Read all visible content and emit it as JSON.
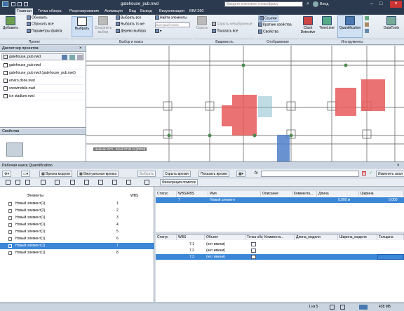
{
  "titlebar": {
    "file": "gatehouse_pub.nwd",
    "search_placeholder": "Введите ключевое слово/фразу",
    "user": "Вход"
  },
  "tabs": [
    "Главная",
    "Точка обзора",
    "Рецензирование",
    "Анимация",
    "Вид",
    "Вывод",
    "Визуализация",
    "BIM 360"
  ],
  "ribbon": {
    "add": "Добавить",
    "refresh": "Обновить",
    "reset_all": "Сбросить все",
    "file_params": "Параметры файла",
    "select": "Выбрать",
    "save_selection": "Сохранить выбор",
    "select_all": "Выбрать все",
    "select_same": "Выбрать то же",
    "selection_tree": "Дерево выбора",
    "find_items": "Найти элементы",
    "quick_find_placeholder": "Быстрый поиск",
    "hide": "Скрыть",
    "hide_unselected": "Скрыть невыбранные",
    "show_all": "Показать все",
    "links": "Ссылки",
    "quick_props": "Краткие свойства",
    "properties": "Свойства",
    "clash": "Clash Detective",
    "timeliner": "TimeLiner",
    "quantification": "Quantification",
    "datatools": "DataTools",
    "groups": {
      "project": "Проект",
      "select_search": "Выбор и поиск",
      "visibility": "Видимость",
      "display": "Отображение",
      "tools": "Инструменты"
    }
  },
  "project_browser": {
    "title": "Диспетчер проектов",
    "files": [
      "gatehouse_pub.nwd",
      "gatehouse_pub.nwd (gatehouse_pub.nwd)",
      "enviro.done.nwd",
      "snowmobile.nwd",
      "ice stadium.nwd"
    ]
  },
  "properties_title": "Свойства",
  "viewport_label": "Hedican OCL, Small Child to [IDEM]",
  "quant": {
    "title": "Рабочая книга Quantification",
    "toolbar": {
      "model_cut": "Врезка модели",
      "virtual_cut": "Виртуальная врезка",
      "select": "Выбрать",
      "hide_cuts": "Скрыть врезки",
      "show_cuts": "Показать врезки",
      "fx": "fx",
      "change": "Изменить анал",
      "filter": "Фильтрация пометок"
    },
    "tree_headers": [
      "Элементы",
      "WBS"
    ],
    "tree_rows": [
      {
        "name": "Новый элемент(1)",
        "wbs": "1"
      },
      {
        "name": "Новый элемент(2)",
        "wbs": "2"
      },
      {
        "name": "Новый элемент(1)",
        "wbs": "3"
      },
      {
        "name": "Новый элемент(1)",
        "wbs": "4"
      },
      {
        "name": "Новый элемент(1)",
        "wbs": "5"
      },
      {
        "name": "Новый элемент(1)",
        "wbs": "6"
      },
      {
        "name": "Новый элемент(1)",
        "wbs": "7"
      },
      {
        "name": "Новый элемент(1)",
        "wbs": "8"
      }
    ],
    "selected_row": 6,
    "grid1_headers": [
      "Статус",
      "WBS/RBS",
      "Имя",
      "Описание",
      "Коммента...",
      "Длина",
      "Ширина"
    ],
    "grid1_row": {
      "wbs": "7",
      "name": "Новый элемент",
      "length": "0,000 м",
      "width": "0,000"
    },
    "grid2_headers": [
      "Статус",
      "WBS",
      "Объект",
      "Точка обз...",
      "Коммента...",
      "Длина_модели",
      "Ширина_модели",
      "Толщина"
    ],
    "grid2_rows": [
      {
        "wbs": "7.1",
        "obj": "(нет имени)"
      },
      {
        "wbs": "7.2",
        "obj": "(нет имени)"
      },
      {
        "wbs": "7.3",
        "obj": "(нет имени)"
      }
    ]
  },
  "status": {
    "page": "1 из 5",
    "mem": "438 МБ"
  }
}
